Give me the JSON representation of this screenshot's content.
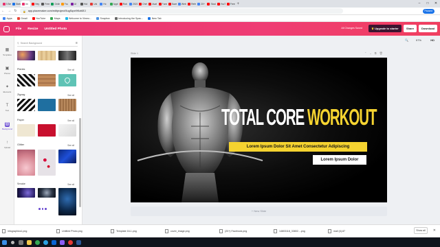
{
  "browser": {
    "tabs": [
      {
        "title": "3 Bes",
        "color": "#e8336d",
        "active": false
      },
      {
        "title": "Sketch",
        "color": "#1a73e8",
        "active": false
      },
      {
        "title": "Im",
        "color": "#e8336d",
        "active": true
      },
      {
        "title": "Hey vi",
        "color": "#ff0000",
        "active": false
      },
      {
        "title": "Free",
        "color": "#555",
        "active": false
      },
      {
        "title": "Onlin",
        "color": "#0f9d58",
        "active": false
      },
      {
        "title": "Fou",
        "color": "#ff9800",
        "active": false
      },
      {
        "title": "UI",
        "color": "#7b1fa2",
        "active": false
      },
      {
        "title": "Hol",
        "color": "#555",
        "active": false
      },
      {
        "title": "Uni",
        "color": "#e53935",
        "active": false
      },
      {
        "title": "Hc",
        "color": "#4285f4",
        "active": false
      },
      {
        "title": "Appt",
        "color": "#34a853",
        "active": false
      },
      {
        "title": "Rob",
        "color": "#ff0000",
        "active": false
      },
      {
        "title": "2021",
        "color": "#4285f4",
        "active": false
      },
      {
        "title": "Chris",
        "color": "#ff0000",
        "active": false
      },
      {
        "title": "Avat",
        "color": "#ff0000",
        "active": false
      },
      {
        "title": "Funny",
        "color": "#ff0000",
        "active": false
      },
      {
        "title": "Save",
        "color": "#ff0000",
        "active": false
      },
      {
        "title": "Webs",
        "color": "#4285f4",
        "active": false
      },
      {
        "title": "Refer",
        "color": "#ff0000",
        "active": false
      },
      {
        "title": "20+",
        "color": "#4285f4",
        "active": false
      },
      {
        "title": "Stock",
        "color": "#ff0000",
        "active": false
      },
      {
        "title": "YouTub",
        "color": "#ff0000",
        "active": false
      },
      {
        "title": "Freebi",
        "color": "#ff0000",
        "active": false
      }
    ],
    "url": "app.placemaker.com/editproject/5ugSqrzt9Kot6EJ",
    "paused_label": "Paused",
    "bookmarks": [
      {
        "label": "Apps",
        "color": "#4285f4"
      },
      {
        "label": "Gmail",
        "color": "#ea4335"
      },
      {
        "label": "YouTube",
        "color": "#ff0000"
      },
      {
        "label": "Maps",
        "color": "#34a853"
      },
      {
        "label": "Welcome to Vimeo...",
        "color": "#1ab7ea"
      },
      {
        "label": "Snapbox",
        "color": "#4a90e2"
      },
      {
        "label": "Introducing the Spac...",
        "color": "#666666"
      },
      {
        "label": "New Tab",
        "color": "#1a73e8"
      }
    ]
  },
  "app": {
    "menu": [
      "File",
      "Resize"
    ],
    "doc_title": "Untitled Photo",
    "saved_status": "All Changes Saved",
    "upgrade_label": "Upgrade to starter",
    "share_label": "Share",
    "download_label": "Download",
    "zoom": "97%",
    "quality": "HD"
  },
  "rail": [
    {
      "label": "Templates",
      "icon": "templates-icon",
      "glyph": "▦",
      "selected": false
    },
    {
      "label": "Photos",
      "icon": "photos-icon",
      "glyph": "▣",
      "selected": false
    },
    {
      "label": "Elements",
      "icon": "elements-icon",
      "glyph": "✦",
      "selected": false
    },
    {
      "label": "Text",
      "icon": "text-icon",
      "glyph": "T",
      "selected": false
    },
    {
      "label": "Background",
      "icon": "background-icon",
      "glyph": "▨",
      "selected": true
    },
    {
      "label": "Upload",
      "icon": "upload-icon",
      "glyph": "↑",
      "selected": false
    }
  ],
  "panel": {
    "search_placeholder": "Search Background",
    "see_all": "See all",
    "categories": [
      "Planks",
      "Zigzag",
      "Paper",
      "Glitter",
      "Smoke"
    ]
  },
  "canvas": {
    "slide_label": "Slide 1",
    "title_white": "TOTAL CORE",
    "title_yellow": "WORKOUT",
    "subtitle": "Lorem Ipsum Dolor Sit Amet Consectetur Adipiscing",
    "tagline": "Lorem Ipsum Dolor",
    "new_slide": "+ New Slide",
    "accent": "#f5d330"
  },
  "downloads": {
    "files": [
      "infographics1.png",
      "Untitled Photo.png",
      "Template 16-1.png",
      "cover_image.png",
      "(20+) Facebook.png",
      "14803118_33802....png",
      "mail (4).87"
    ],
    "show_all": "Show all"
  }
}
